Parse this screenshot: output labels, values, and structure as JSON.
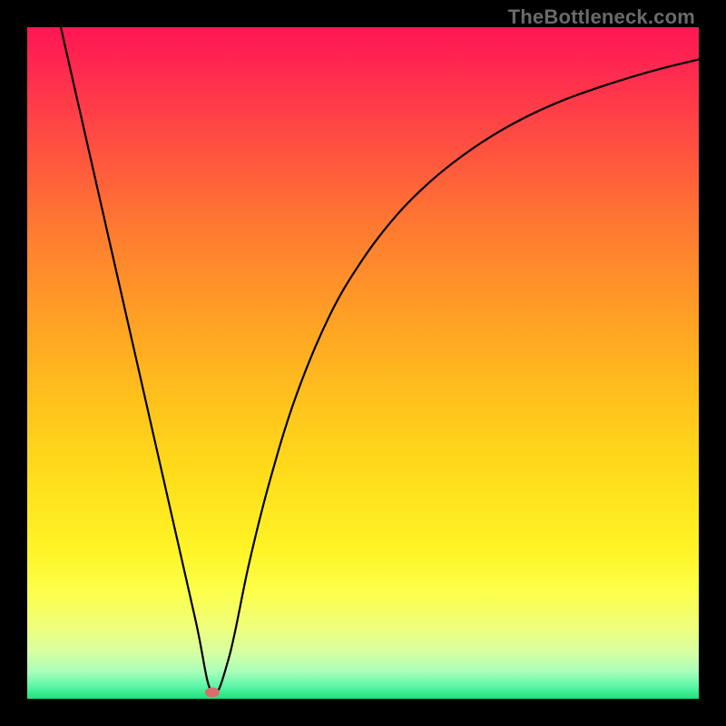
{
  "watermark": "TheBottleneck.com",
  "chart_data": {
    "type": "line",
    "title": "",
    "xlabel": "",
    "ylabel": "",
    "xlim": [
      0,
      100
    ],
    "ylim": [
      0,
      100
    ],
    "grid": false,
    "series": [
      {
        "name": "curve",
        "x": [
          5,
          10,
          15,
          20,
          25,
          27.5,
          30,
          33,
          36,
          40,
          45,
          50,
          55,
          60,
          65,
          70,
          75,
          80,
          85,
          90,
          95,
          100
        ],
        "y": [
          100,
          78,
          56,
          34,
          12,
          1,
          6,
          20,
          32,
          45,
          57,
          65.5,
          72,
          77,
          81,
          84.3,
          87,
          89.2,
          91,
          92.6,
          94,
          95.2
        ]
      }
    ],
    "marker": {
      "x": 27.5,
      "y": 1,
      "color": "#d96d6d"
    },
    "background_gradient": {
      "top": "#ff1653",
      "bottom": "#1ae37f"
    }
  }
}
